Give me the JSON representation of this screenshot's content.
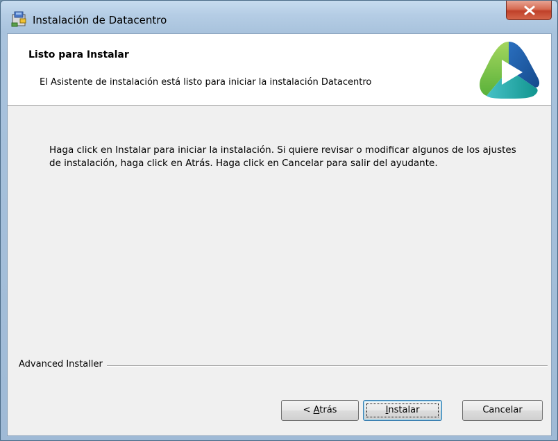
{
  "window": {
    "title": "Instalación de Datacentro"
  },
  "header": {
    "title": "Listo para Instalar",
    "subtitle": "El Asistente de instalación está listo para iniciar la instalación Datacentro"
  },
  "body": {
    "text": "Haga click en Instalar para iniciar la instalación. Si quiere revisar o modificar algunos de los ajustes de instalación, haga click en Atrás. Haga click en Cancelar para salir del ayudante."
  },
  "footer": {
    "brand": "Advanced Installer"
  },
  "buttons": {
    "back_prefix": "< ",
    "back_mnemonic": "A",
    "back_rest": "trás",
    "install_mnemonic": "I",
    "install_rest": "nstalar",
    "cancel": "Cancelar"
  },
  "icons": {
    "title": "installer-package-icon",
    "close": "close-icon",
    "logo": "datacentro-logo"
  },
  "colors": {
    "close_red": "#c0412a",
    "logo_blue": "#1f5fa8",
    "logo_green": "#8cc63e",
    "logo_teal": "#1aa9a0"
  }
}
